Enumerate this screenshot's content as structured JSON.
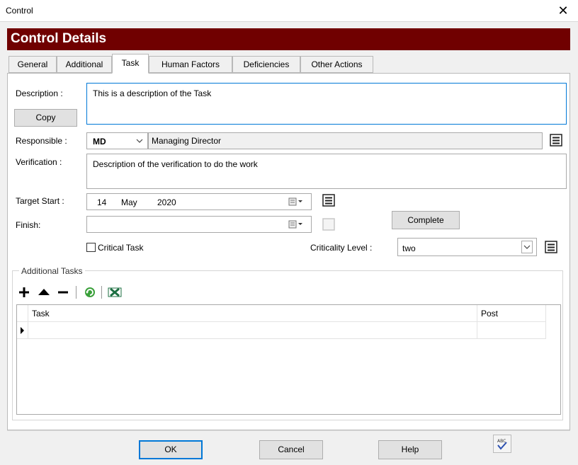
{
  "window": {
    "title": "Control"
  },
  "banner": {
    "title": "Control Details"
  },
  "tabs": [
    {
      "label": "General"
    },
    {
      "label": "Additional"
    },
    {
      "label": "Task"
    },
    {
      "label": "Human Factors"
    },
    {
      "label": "Deficiencies"
    },
    {
      "label": "Other Actions"
    }
  ],
  "form": {
    "description_label": "Description :",
    "description_value": "This is a description of the Task",
    "copy_label": "Copy",
    "responsible_label": "Responsible :",
    "responsible_code": "MD",
    "responsible_name": "Managing Director",
    "verification_label": "Verification :",
    "verification_value": "Description of the verification to do the work",
    "target_start_label": "Target Start :",
    "target_start": {
      "day": "14",
      "month": "May",
      "year": "2020"
    },
    "finish_label": "Finish:",
    "finish_value": "",
    "complete_label": "Complete",
    "critical_task_label": "Critical Task",
    "critical_task_checked": false,
    "criticality_label": "Criticality Level :",
    "criticality_value": "two"
  },
  "additional_tasks": {
    "group_label": "Additional Tasks",
    "columns": [
      "Task",
      "Post"
    ],
    "rows": []
  },
  "footer": {
    "ok_label": "OK",
    "cancel_label": "Cancel",
    "help_label": "Help"
  },
  "colors": {
    "banner": "#700000",
    "focus": "#0078d7"
  }
}
